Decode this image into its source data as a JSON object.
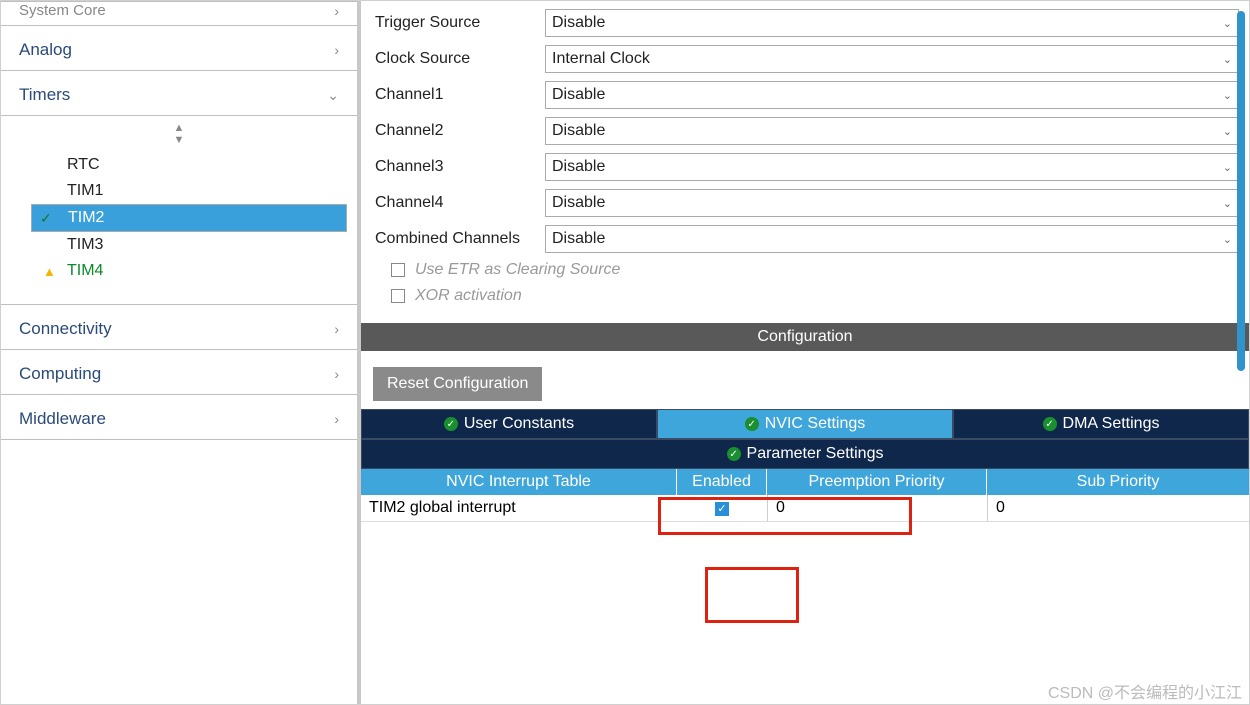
{
  "sidebar": {
    "cats": [
      "System Core",
      "Analog",
      "Timers",
      "Connectivity",
      "Computing",
      "Middleware"
    ],
    "items": [
      "RTC",
      "TIM1",
      "TIM2",
      "TIM3",
      "TIM4"
    ]
  },
  "form": {
    "rows": [
      {
        "label": "Trigger Source",
        "value": "Disable"
      },
      {
        "label": "Clock Source",
        "value": "Internal Clock"
      },
      {
        "label": "Channel1",
        "value": "Disable"
      },
      {
        "label": "Channel2",
        "value": "Disable"
      },
      {
        "label": "Channel3",
        "value": "Disable"
      },
      {
        "label": "Channel4",
        "value": "Disable"
      },
      {
        "label": "Combined Channels",
        "value": "Disable"
      }
    ],
    "checks": [
      "Use ETR as Clearing Source",
      "XOR activation"
    ]
  },
  "config": {
    "title": "Configuration",
    "reset": "Reset Configuration",
    "tabs": [
      "User Constants",
      "NVIC Settings",
      "DMA Settings",
      "Parameter Settings"
    ],
    "cols": [
      "NVIC Interrupt Table",
      "Enabled",
      "Preemption Priority",
      "Sub Priority"
    ],
    "row": {
      "name": "TIM2 global interrupt",
      "enabled": true,
      "pre": "0",
      "sub": "0"
    }
  },
  "watermark": "CSDN @不会编程的小江江"
}
